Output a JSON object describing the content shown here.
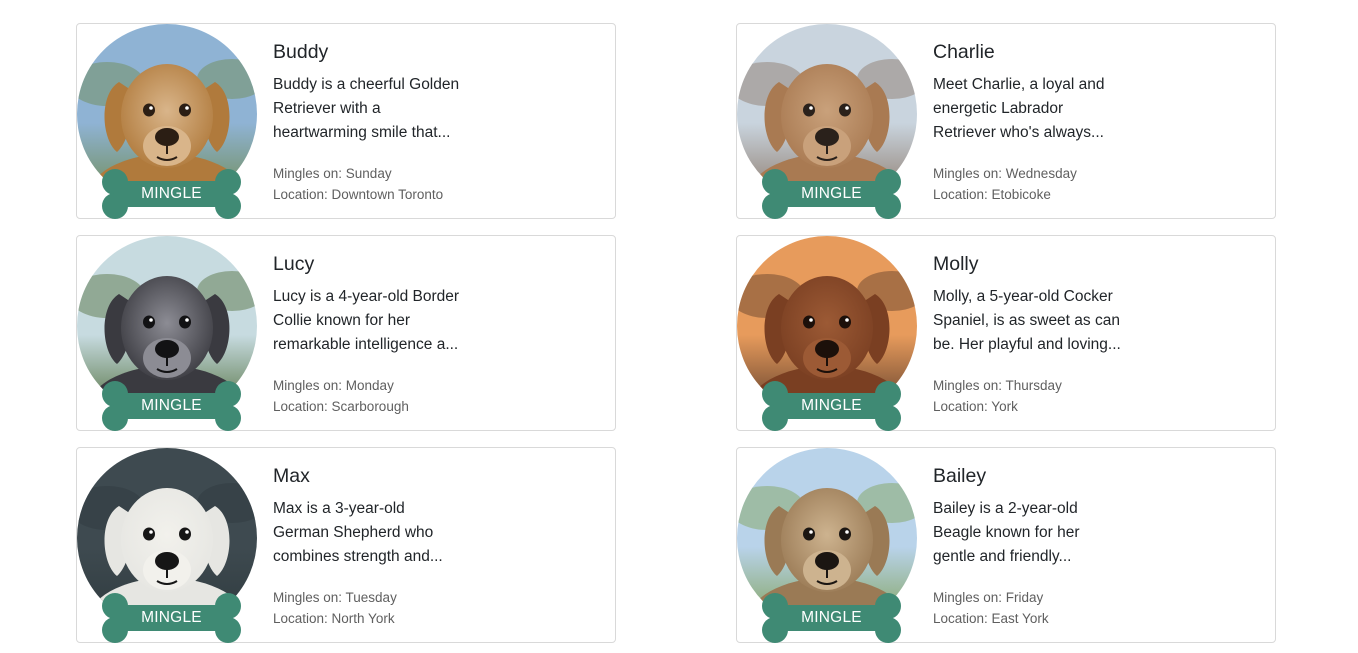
{
  "accent_color": "#3f8a74",
  "mingle_label": "MINGLE",
  "dogs": [
    {
      "name": "Buddy",
      "description_lines": [
        "Buddy is a cheerful Golden",
        "Retriever with a",
        "heartwarming smile that..."
      ],
      "mingles_on": "Mingles on: Sunday",
      "location": "Location: Downtown Toronto",
      "palette": {
        "sky": "#8fb3d4",
        "ground": "#6f8a4e",
        "fur": "#b07a3c",
        "face": "#d9b58a",
        "dark": "#2b1e14"
      }
    },
    {
      "name": "Charlie",
      "description_lines": [
        "Meet Charlie, a loyal and",
        "energetic Labrador",
        "Retriever who's always..."
      ],
      "mingles_on": "Mingles on: Wednesday",
      "location": "Location: Etobicoke",
      "palette": {
        "sky": "#c9d4de",
        "ground": "#8a7666",
        "fur": "#a97a52",
        "face": "#c9a17b",
        "dark": "#2a211b"
      }
    },
    {
      "name": "Lucy",
      "description_lines": [
        "Lucy is a 4-year-old Border",
        "Collie known for her",
        "remarkable intelligence a..."
      ],
      "mingles_on": "Mingles on: Monday",
      "location": "Location: Scarborough",
      "palette": {
        "sky": "#c7dbe0",
        "ground": "#4f6d3a",
        "fur": "#3a3a40",
        "face": "#8c8c94",
        "dark": "#121214"
      }
    },
    {
      "name": "Molly",
      "description_lines": [
        "Molly, a 5-year-old Cocker",
        "Spaniel, is as sweet as can",
        "be. Her playful and loving..."
      ],
      "mingles_on": "Mingles on: Thursday",
      "location": "Location: York",
      "palette": {
        "sky": "#e79b5c",
        "ground": "#5a3b2a",
        "fur": "#7a3f22",
        "face": "#9c5a35",
        "dark": "#1c100a"
      }
    },
    {
      "name": "Max",
      "description_lines": [
        "Max is a 3-year-old",
        "German Shepherd who",
        "combines strength and..."
      ],
      "mingles_on": "Mingles on: Tuesday",
      "location": "Location: North York",
      "palette": {
        "sky": "#3e4a50",
        "ground": "#2f3a3e",
        "fur": "#e6e6e2",
        "face": "#f2f1ec",
        "dark": "#161616"
      }
    },
    {
      "name": "Bailey",
      "description_lines": [
        "Bailey is a 2-year-old",
        "Beagle known for her",
        "gentle and friendly..."
      ],
      "mingles_on": "Mingles on: Friday",
      "location": "Location: East York",
      "palette": {
        "sky": "#b9d3ea",
        "ground": "#7fa055",
        "fur": "#9a7a55",
        "face": "#cdb38f",
        "dark": "#1b1612"
      }
    }
  ]
}
